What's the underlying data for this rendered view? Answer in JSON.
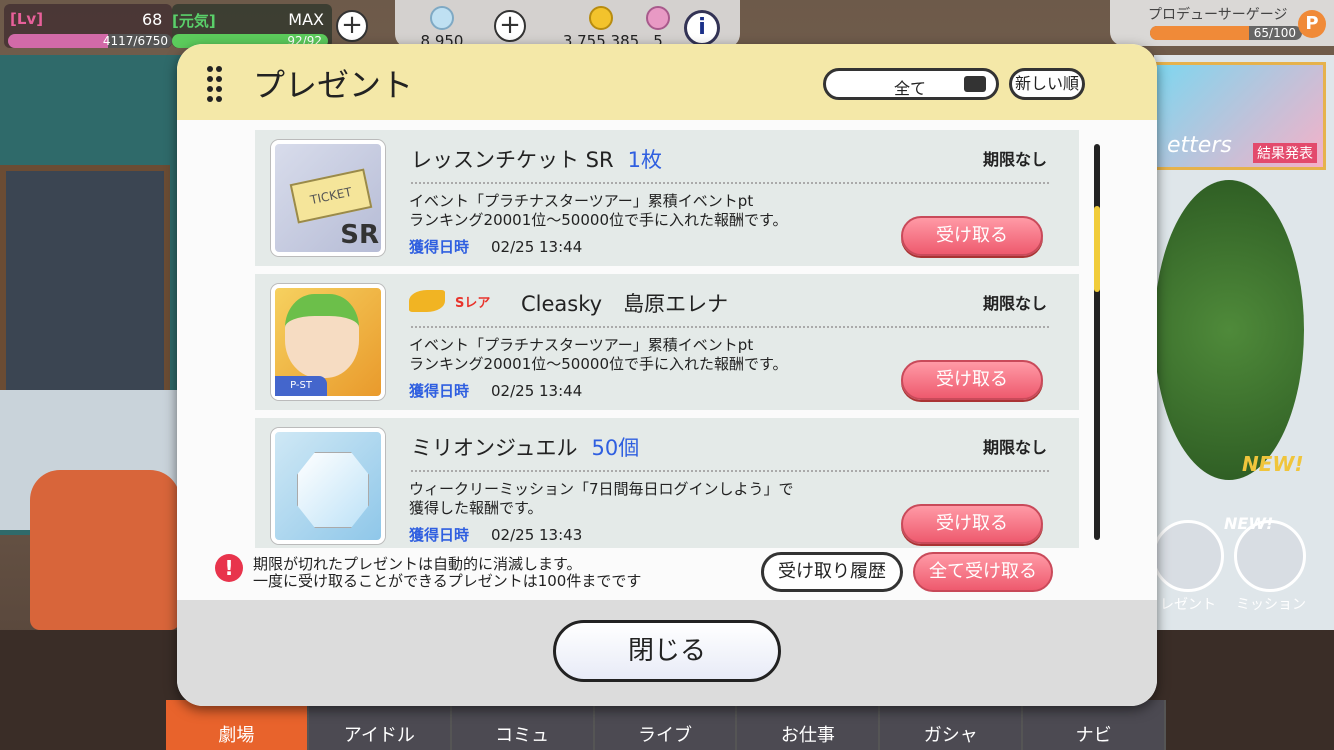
{
  "hud": {
    "lv_tag": "[Lv]",
    "lv_value": "68",
    "lv_exp": "4117/6750",
    "lv_progress": 0.61,
    "genki_tag": "[元気]",
    "genki_max": "MAX",
    "genki_value": "92/92",
    "genki_progress": 1.0,
    "jewel_count": "8,950",
    "money": "3,755,385",
    "ticket_count": "5",
    "producer_label": "プロデューサーゲージ",
    "producer_value": "65/100",
    "producer_progress": 0.65,
    "producer_badge": "P"
  },
  "side": {
    "banner_text": "etters",
    "banner_tag": "結果発表",
    "new_badge": "NEW!",
    "new_badge2": "NEW!",
    "present_label": "レゼント",
    "mission_label": "ミッション"
  },
  "nav": {
    "items": [
      "劇場",
      "アイドル",
      "コミュ",
      "ライブ",
      "お仕事",
      "ガシャ",
      "ナビ"
    ]
  },
  "modal": {
    "title": "プレゼント",
    "filter": "全て",
    "sort": "新しい順",
    "items": [
      {
        "title": "レッスンチケット SR",
        "qty": "1枚",
        "expiry": "期限なし",
        "desc1": "イベント「プラチナスターツアー」累積イベントpt",
        "desc2": "ランキング20001位～50000位で手に入れた報酬です。",
        "date_label": "獲得日時",
        "date": "02/25 13:44",
        "button": "受け取る",
        "thumb_text": "TICKET",
        "thumb_sr": "SR"
      },
      {
        "rarity": "Sレア",
        "title": "Cleasky　島原エレナ",
        "expiry": "期限なし",
        "desc1": "イベント「プラチナスターツアー」累積イベントpt",
        "desc2": "ランキング20001位～50000位で手に入れた報酬です。",
        "date_label": "獲得日時",
        "date": "02/25 13:44",
        "button": "受け取る",
        "thumb_tag": "P-ST"
      },
      {
        "title": "ミリオンジュエル",
        "qty": "50個",
        "expiry": "期限なし",
        "desc1": "ウィークリーミッション「7日間毎日ログインしよう」で",
        "desc2": "獲得した報酬です。",
        "date_label": "獲得日時",
        "date": "02/25 13:43",
        "button": "受け取る"
      }
    ],
    "notice_icon": "!",
    "notice1": "期限が切れたプレゼントは自動的に消滅します。",
    "notice2": "一度に受け取ることができるプレゼントは100件までです",
    "history_button": "受け取り履歴",
    "receive_all_button": "全て受け取る",
    "close_button": "閉じる"
  },
  "colors": {
    "header": "#f4e8a8",
    "receive": "#ee5a6e",
    "accent_blue": "#2f5fe0",
    "nav_active": "#e8632c"
  }
}
